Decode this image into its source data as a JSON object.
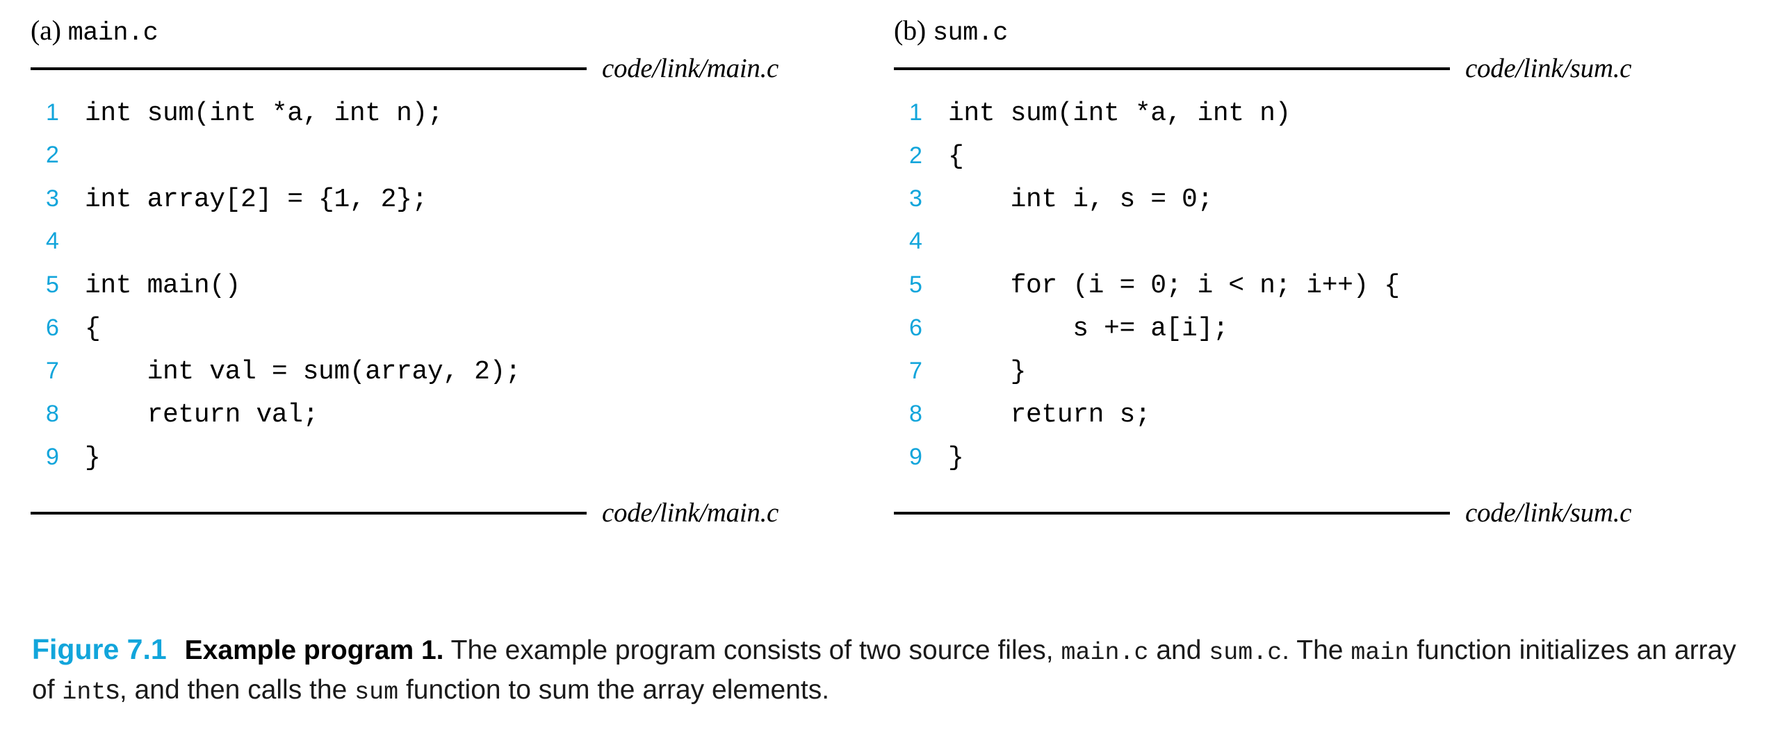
{
  "figure": {
    "number_label": "Figure 7.1",
    "title": "Example program 1.",
    "caption_parts": {
      "t1": " The example program consists of two source files, ",
      "m1": "main.c",
      "t2": " and ",
      "m2": "sum.c",
      "t3": ". The ",
      "m3": "main",
      "t4": " function initializes an array of ",
      "m4": "int",
      "t5": "s, and then calls the ",
      "m5": "sum",
      "t6": " function to sum the array elements."
    }
  },
  "panels": [
    {
      "label_paren": "(a)",
      "label_file": "main.c",
      "path_top": "code/link/main.c",
      "path_bottom": "code/link/main.c",
      "lines": [
        {
          "n": "1",
          "text": "int sum(int *a, int n);"
        },
        {
          "n": "2",
          "text": ""
        },
        {
          "n": "3",
          "text": "int array[2] = {1, 2};"
        },
        {
          "n": "4",
          "text": ""
        },
        {
          "n": "5",
          "text": "int main()"
        },
        {
          "n": "6",
          "text": "{"
        },
        {
          "n": "7",
          "text": "    int val = sum(array, 2);"
        },
        {
          "n": "8",
          "text": "    return val;"
        },
        {
          "n": "9",
          "text": "}"
        }
      ]
    },
    {
      "label_paren": "(b)",
      "label_file": "sum.c",
      "path_top": "code/link/sum.c",
      "path_bottom": "code/link/sum.c",
      "lines": [
        {
          "n": "1",
          "text": "int sum(int *a, int n)"
        },
        {
          "n": "2",
          "text": "{"
        },
        {
          "n": "3",
          "text": "    int i, s = 0;"
        },
        {
          "n": "4",
          "text": ""
        },
        {
          "n": "5",
          "text": "    for (i = 0; i < n; i++) {"
        },
        {
          "n": "6",
          "text": "        s += a[i];"
        },
        {
          "n": "7",
          "text": "    }"
        },
        {
          "n": "8",
          "text": "    return s;"
        },
        {
          "n": "9",
          "text": "}"
        }
      ]
    }
  ],
  "colors": {
    "accent": "#12a5db",
    "text": "#000000",
    "background": "#ffffff"
  }
}
